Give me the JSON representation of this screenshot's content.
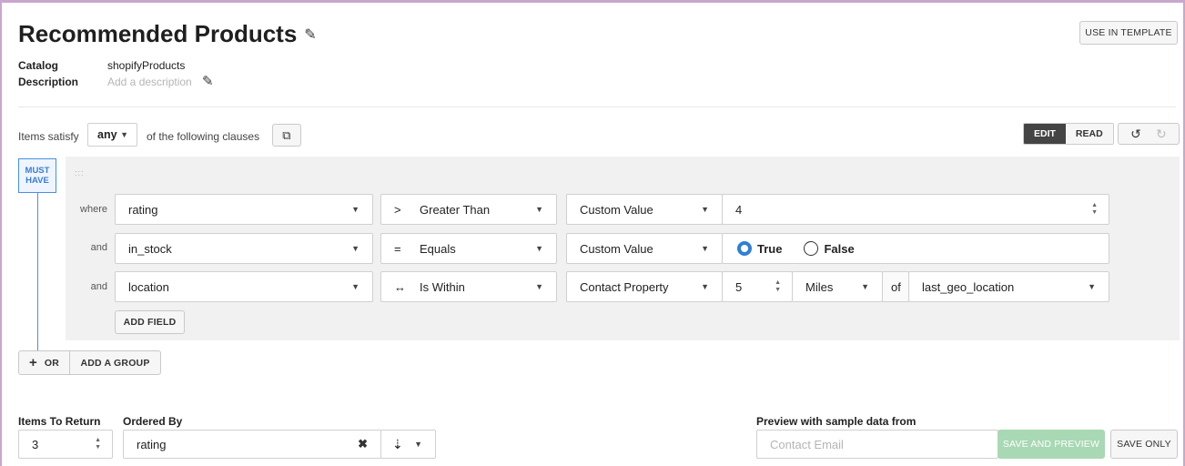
{
  "header": {
    "title": "Recommended Products",
    "use_in_template": "USE IN TEMPLATE"
  },
  "meta": {
    "catalog_label": "Catalog",
    "catalog_value": "shopifyProducts",
    "description_label": "Description",
    "description_placeholder": "Add a description"
  },
  "clauses": {
    "prefix": "Items satisfy",
    "mode": "any",
    "suffix": "of the following clauses",
    "edit": "EDIT",
    "read": "READ"
  },
  "group": {
    "badge_line1": "MUST",
    "badge_line2": "HAVE",
    "drag_handle": ":::",
    "rows": [
      {
        "connector": "where",
        "field": "rating",
        "op_symbol": ">",
        "operator": "Greater Than",
        "value_type": "Custom Value",
        "value": "4"
      },
      {
        "connector": "and",
        "field": "in_stock",
        "op_symbol": "=",
        "operator": "Equals",
        "value_type": "Custom Value",
        "true_label": "True",
        "false_label": "False",
        "selected": "True"
      },
      {
        "connector": "and",
        "field": "location",
        "op_symbol": "↔",
        "operator": "Is Within",
        "value_type": "Contact Property",
        "distance": "5",
        "unit": "Miles",
        "of_label": "of",
        "property": "last_geo_location"
      }
    ],
    "add_field": "ADD FIELD"
  },
  "actions": {
    "or": "OR",
    "add_group": "ADD A GROUP"
  },
  "footer": {
    "items_label": "Items To Return",
    "items_value": "3",
    "ordered_label": "Ordered By",
    "ordered_value": "rating",
    "preview_label": "Preview with sample data from",
    "email_placeholder": "Contact Email",
    "save_preview": "SAVE AND PREVIEW",
    "save_only": "SAVE ONLY"
  },
  "colors": {
    "accent": "#2f7fd8",
    "frame": "#c9a6cf",
    "save_preview_bg": "#a9d8b4"
  }
}
